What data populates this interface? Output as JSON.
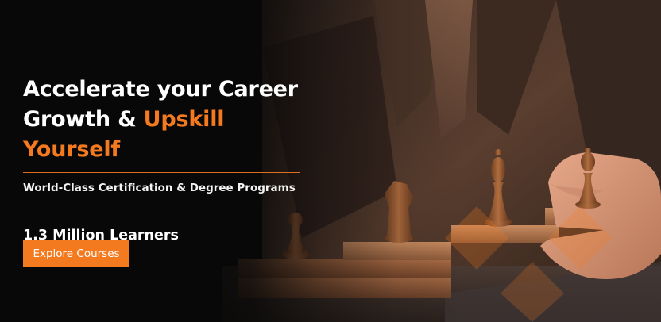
{
  "banner": {
    "headline_line1": "Accelerate your Career",
    "headline_line2_prefix": "Growth & ",
    "headline_line2_accent": "Upskill Yourself",
    "subtitle": "World-Class Certification & Degree Programs",
    "learners": "1.3 Million Learners",
    "cta_label": "Explore Courses"
  },
  "colors": {
    "accent": "#f47a20",
    "background": "#0a0a0a",
    "text": "#ffffff"
  }
}
